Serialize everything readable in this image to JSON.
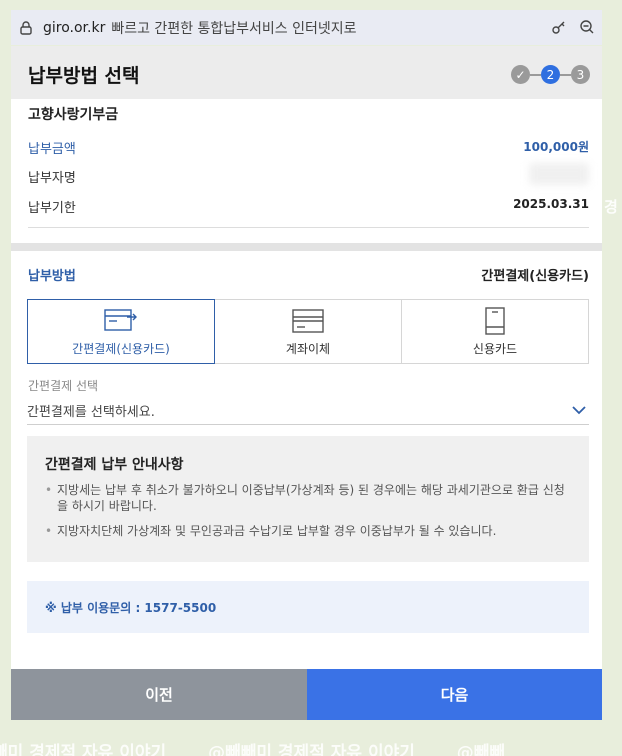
{
  "browser": {
    "domain": "giro.or.kr",
    "title": "빠르고 간편한 통합납부서비스 인터넷지로"
  },
  "header": {
    "title": "납부방법 선택",
    "steps": [
      "✓",
      "2",
      "3"
    ]
  },
  "bill": {
    "tax_name": "고향사랑기부금",
    "amount_label": "납부금액",
    "amount_value": "100,000원",
    "payer_label": "납부자명",
    "due_label": "납부기한",
    "due_value": "2025.03.31"
  },
  "payment": {
    "method_label": "납부방법",
    "method_value": "간편결제(신용카드)",
    "tabs": [
      {
        "label": "간편결제(신용카드)",
        "icon": "easy-pay-icon"
      },
      {
        "label": "계좌이체",
        "icon": "bank-transfer-icon"
      },
      {
        "label": "신용카드",
        "icon": "credit-card-icon"
      }
    ],
    "select_label": "간편결제 선택",
    "select_placeholder": "간편결제를 선택하세요."
  },
  "notice": {
    "title": "간편결제 납부 안내사항",
    "items": [
      "지방세는 납부 후 취소가 불가하오니 이중납부(가상계좌 등) 된 경우에는 해당 과세기관으로 환급 신청을 하시기 바랍니다.",
      "지방자치단체 가상계좌 및 무인공과금 수납기로 납부할 경우 이중납부가 될 수 있습니다."
    ]
  },
  "contact": "※ 납부 이용문의 : 1577-5500",
  "buttons": {
    "prev": "이전",
    "next": "다음"
  },
  "watermark": {
    "text_1": "빼미 경제적 자유 이야기",
    "text_2": "@빼빼미 경제적 자유 이야기",
    "text_3": "@빼빼",
    "side": "경"
  },
  "colors": {
    "accent": "#2f5fa8",
    "primary_button": "#3a72e6",
    "secondary_button": "#8e949c"
  }
}
